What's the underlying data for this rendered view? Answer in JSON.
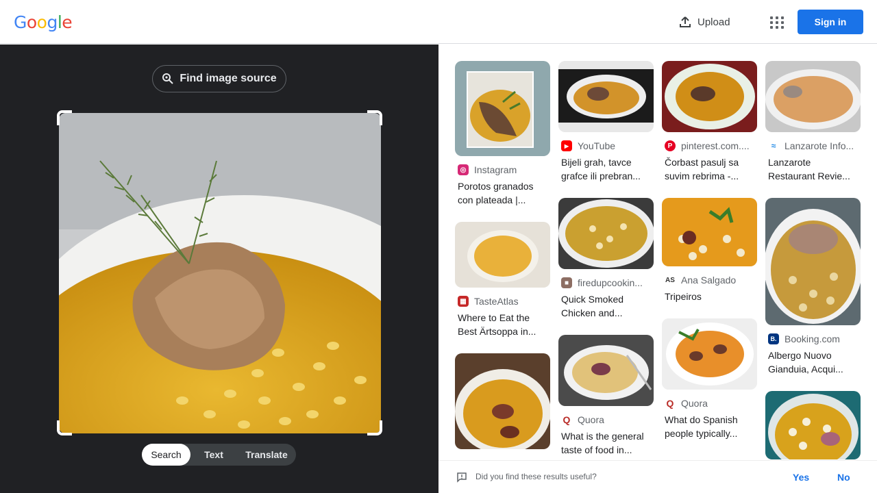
{
  "header": {
    "logo_letters": [
      "G",
      "o",
      "o",
      "g",
      "l",
      "e"
    ],
    "logo_colors": [
      "#4285f4",
      "#ea4335",
      "#fbbc05",
      "#4285f4",
      "#34a853",
      "#ea4335"
    ],
    "upload_label": "Upload",
    "signin_label": "Sign in"
  },
  "left_panel": {
    "find_source_label": "Find image source",
    "modes": [
      "Search",
      "Text",
      "Translate"
    ],
    "active_mode": "Search"
  },
  "results": [
    {
      "source": "Instagram",
      "title": "Porotos granados con plateada |...",
      "favicon": "instagram-icon",
      "fav_color": "#d62976"
    },
    {
      "source": "TasteAtlas",
      "title": "Where to Eat the Best Ärtsoppa in...",
      "favicon": "tasteatlas-icon",
      "fav_color": "#c62828"
    },
    {
      "source": "YouTube",
      "title": "Bijeli grah, tavce grafce ili prebran...",
      "favicon": "youtube-icon",
      "fav_color": "#ff0000"
    },
    {
      "source": "firedupcookin...",
      "title": "Quick Smoked Chicken and...",
      "favicon": "firedup-icon",
      "fav_color": "#8d6e63"
    },
    {
      "source": "Quora",
      "title": "What is the general taste of food in...",
      "favicon": "quora-icon",
      "fav_color": "#b92b27"
    },
    {
      "source": "pinterest.com....",
      "title": "Čorbast pasulj sa suvim rebrima -...",
      "favicon": "pinterest-icon",
      "fav_color": "#e60023"
    },
    {
      "source": "Ana Salgado",
      "title": "Tripeiros",
      "favicon": "ana-salgado-icon",
      "fav_color": "#333333"
    },
    {
      "source": "Quora",
      "title": "What do Spanish people typically...",
      "favicon": "quora-icon",
      "fav_color": "#b92b27"
    },
    {
      "source": "Lanzarote Info...",
      "title": "Lanzarote Restaurant Revie...",
      "favicon": "lanzarote-icon",
      "fav_color": "#1e88e5"
    },
    {
      "source": "Booking.com",
      "title": "Albergo Nuovo Gianduia, Acqui...",
      "favicon": "booking-icon",
      "fav_color": "#003580"
    }
  ],
  "favicon_glyphs": {
    "instagram-icon": "◎",
    "tasteatlas-icon": "▦",
    "youtube-icon": "▶",
    "firedup-icon": "■",
    "quora-icon": "Q",
    "pinterest-icon": "P",
    "ana-salgado-icon": "AS",
    "lanzarote-icon": "≈",
    "booking-icon": "B."
  },
  "feedback": {
    "question": "Did you find these results useful?",
    "yes_label": "Yes",
    "no_label": "No"
  }
}
